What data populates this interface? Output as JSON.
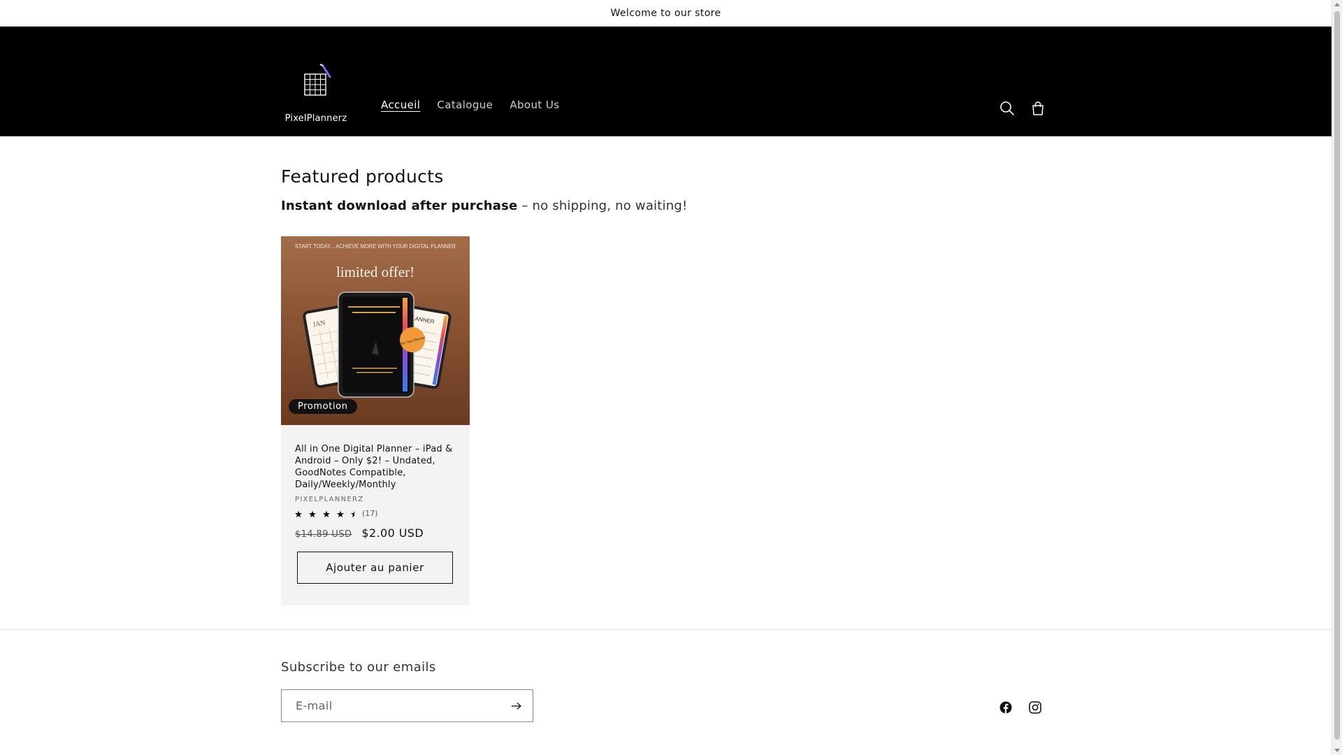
{
  "announcement": {
    "text": "Welcome to our store"
  },
  "header": {
    "logo_text": "PixelPlannerz",
    "nav": [
      {
        "label": "Accueil",
        "active": true
      },
      {
        "label": "Catalogue",
        "active": false
      },
      {
        "label": "About Us",
        "active": false
      }
    ],
    "icons": {
      "search": "search-icon",
      "cart": "cart-icon"
    }
  },
  "featured": {
    "title": "Featured products",
    "subtitle_bold": "Instant download after purchase",
    "subtitle_rest": " – no shipping, no waiting!"
  },
  "product": {
    "image": {
      "top_text": "START TODAY... ACHIEVE MORE WITH YOUR DIGITAL PLANNER",
      "headline": "limited offer!",
      "left_screen": "JAN",
      "right_screen": "E PLANNER",
      "sticker": "Get Your Planner"
    },
    "badge": "Promotion",
    "title": "All in One Digital Planner – iPad & Android – Only $2! – Undated, GoodNotes Compatible, Daily/Weekly/Monthly",
    "vendor": "PIXELPLANNERZ",
    "rating_value": 4.5,
    "rating_max": 5,
    "rating_count": "(17)",
    "price_old": "$14.89 USD",
    "price_new": "$2.00 USD",
    "add_to_cart": "Ajouter au panier"
  },
  "footer": {
    "subscribe_title": "Subscribe to our emails",
    "email_placeholder": "E-mail",
    "social": [
      "facebook-icon",
      "instagram-icon"
    ]
  },
  "colors": {
    "header_bg": "#000000",
    "card_bg": "#f3f3f3",
    "text": "#121212"
  }
}
